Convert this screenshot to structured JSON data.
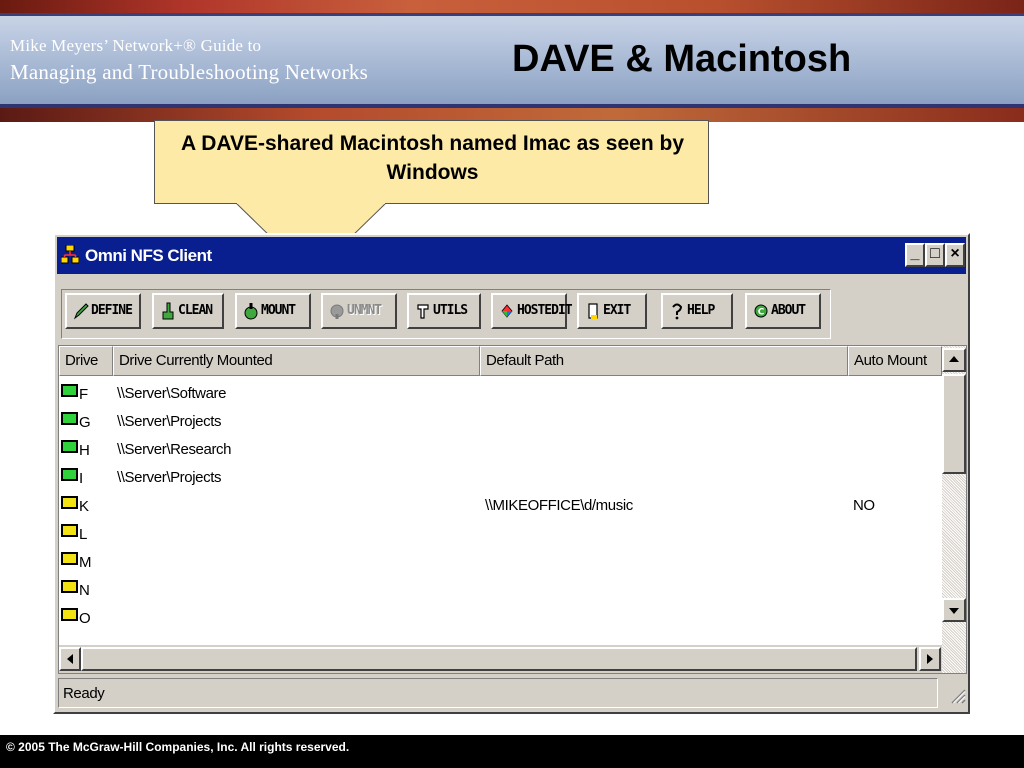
{
  "slide": {
    "brand_line1": "Mike Meyers’ Network+® Guide to",
    "brand_line2": "Managing and Troubleshooting Networks",
    "title": "DAVE & Macintosh",
    "callout": "A DAVE-shared Macintosh named Imac as seen by Windows",
    "footer": "© 2005 The McGraw-Hill Companies, Inc.  All rights reserved."
  },
  "window": {
    "title": "Omni NFS Client",
    "caption_buttons": {
      "minimize": "_",
      "maximize": "□",
      "close": "×"
    },
    "toolbar": [
      {
        "label": "Define",
        "icon": "pencil-icon",
        "enabled": true
      },
      {
        "label": "Clean",
        "icon": "broom-icon",
        "enabled": true
      },
      {
        "label": "Mount",
        "icon": "mount-icon",
        "enabled": true
      },
      {
        "label": "Unmnt",
        "icon": "unmount-icon",
        "enabled": false
      },
      {
        "label": "Utils",
        "icon": "wrench-icon",
        "enabled": true
      },
      {
        "label": "Hostedit",
        "icon": "hosts-icon",
        "enabled": true
      },
      {
        "label": "Exit",
        "icon": "door-icon",
        "enabled": true
      },
      {
        "label": "Help",
        "icon": "question-icon",
        "enabled": true
      },
      {
        "label": "About",
        "icon": "about-icon",
        "enabled": true
      }
    ],
    "columns": [
      "Drive",
      "Drive Currently Mounted",
      "Default Path",
      "Auto Mount"
    ],
    "rows": [
      {
        "drive": "F",
        "mounted": "\\\\Server\\Software",
        "path": "",
        "auto": "",
        "status_color": "#2fd23a"
      },
      {
        "drive": "G",
        "mounted": "\\\\Server\\Projects",
        "path": "",
        "auto": "",
        "status_color": "#2fd23a"
      },
      {
        "drive": "H",
        "mounted": "\\\\Server\\Research",
        "path": "",
        "auto": "",
        "status_color": "#2fd23a"
      },
      {
        "drive": "I",
        "mounted": "\\\\Server\\Projects",
        "path": "",
        "auto": "",
        "status_color": "#2fd23a"
      },
      {
        "drive": "K",
        "mounted": "",
        "path": "\\\\MIKEOFFICE\\d/music",
        "auto": "NO",
        "status_color": "#f2e214"
      },
      {
        "drive": "L",
        "mounted": "",
        "path": "",
        "auto": "",
        "status_color": "#f2e214"
      },
      {
        "drive": "M",
        "mounted": "",
        "path": "",
        "auto": "",
        "status_color": "#f2e214"
      },
      {
        "drive": "N",
        "mounted": "",
        "path": "",
        "auto": "",
        "status_color": "#f2e214"
      },
      {
        "drive": "O",
        "mounted": "",
        "path": "",
        "auto": "",
        "status_color": "#f2e214"
      }
    ],
    "status": "Ready"
  }
}
